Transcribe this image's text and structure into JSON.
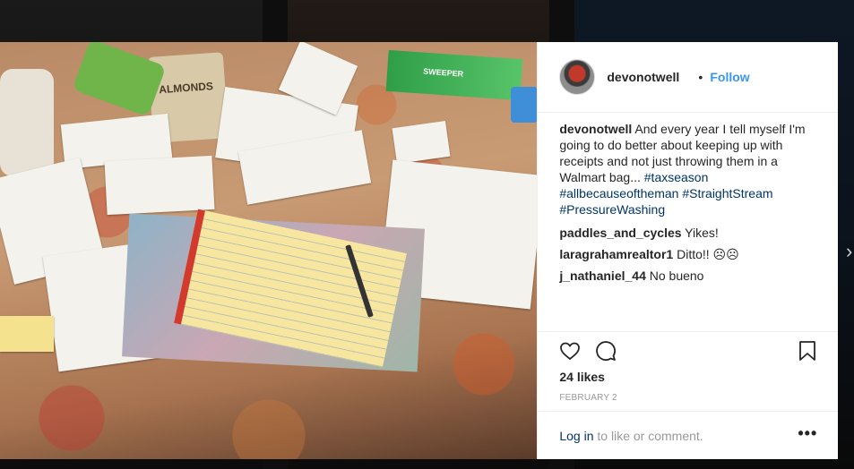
{
  "post": {
    "author": "devonotwell",
    "separator": "•",
    "follow_label": "Follow",
    "caption": {
      "user": "devonotwell",
      "text": " And every year I tell myself I'm going to do better about keeping up with receipts and not just throwing them in a Walmart bag... ",
      "hashtags": [
        "#taxseason",
        "#allbecauseoftheman",
        "#StraightStream",
        "#PressureWashing"
      ]
    },
    "comments": [
      {
        "user": "paddles_and_cycles",
        "text": " Yikes!"
      },
      {
        "user": "laragrahamrealtor1",
        "text": " Ditto!! ☹☹"
      },
      {
        "user": "j_nathaniel_44",
        "text": " No bueno"
      }
    ],
    "likes": "24 likes",
    "date": "FEBRUARY 2",
    "login_link": "Log in",
    "login_rest": " to like or comment.",
    "more_label": "•••"
  },
  "photo": {
    "bag_text": "ALMONDS",
    "box_text": "SWEEPER"
  },
  "icons": {
    "like": "heart-icon",
    "comment": "comment-icon",
    "save": "bookmark-icon",
    "next": "chevron-right-icon"
  },
  "colors": {
    "accent": "#3897f0",
    "hashtag": "#003569",
    "text": "#262626",
    "muted": "#999999"
  },
  "nav": {
    "next_glyph": "›"
  }
}
